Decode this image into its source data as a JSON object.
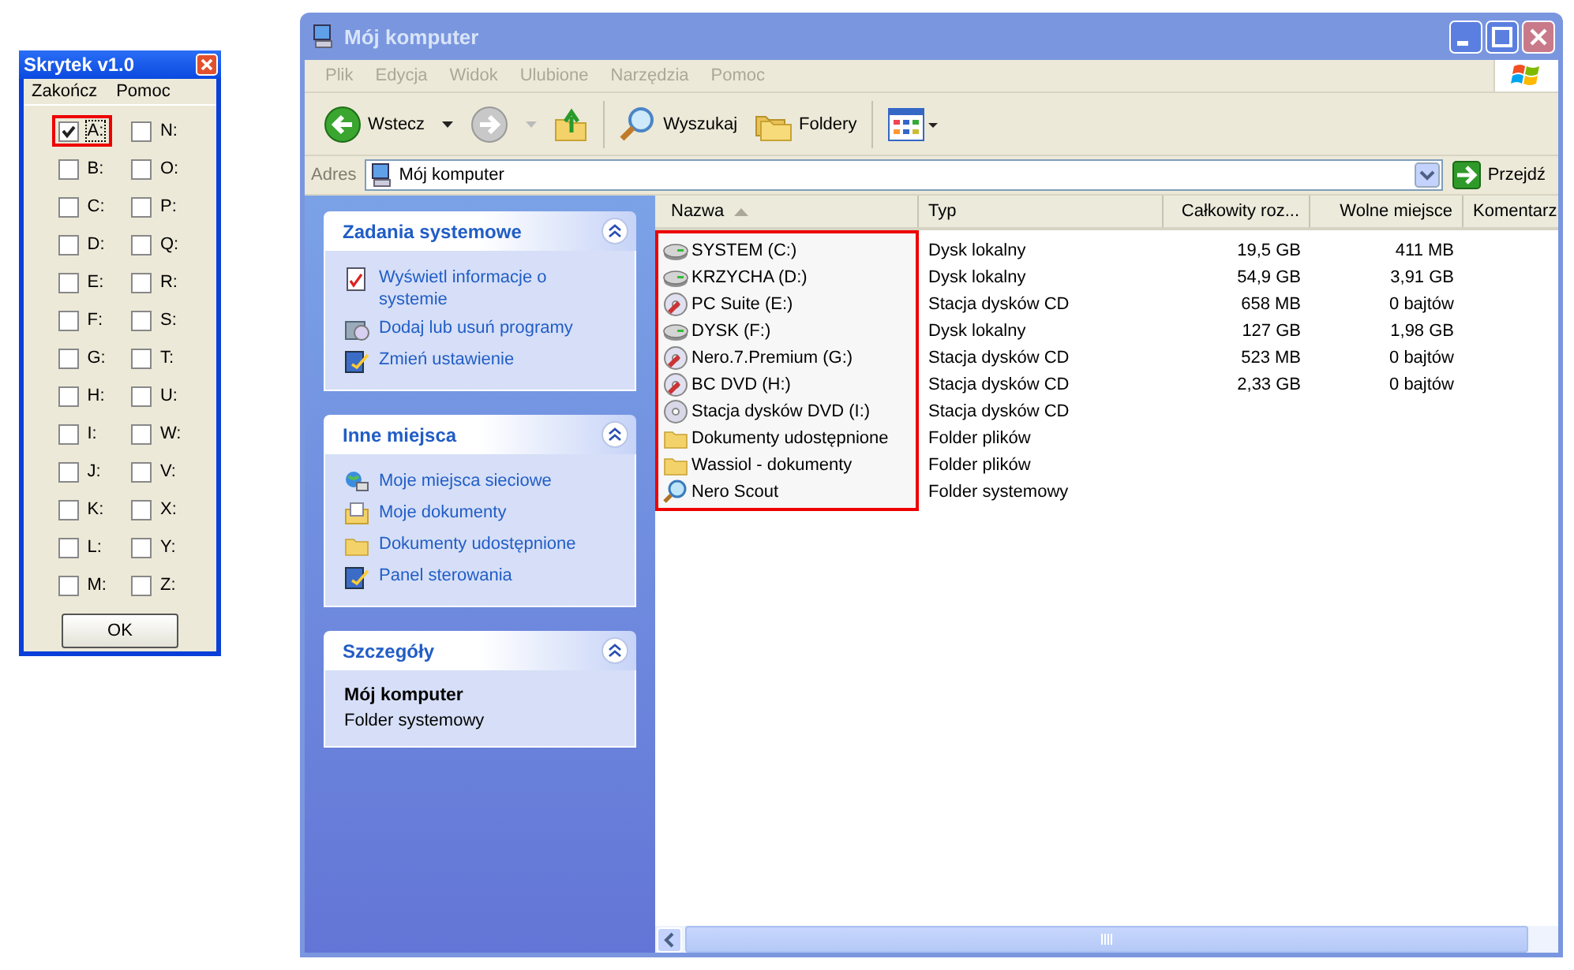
{
  "dialog": {
    "title": "Skrytek v1.0",
    "menu": [
      "Zakończ",
      "Pomoc"
    ],
    "drive_columns": [
      [
        {
          "label": "A:",
          "checked": true,
          "highlighted": true
        },
        {
          "label": "B:",
          "checked": false,
          "highlighted": false
        },
        {
          "label": "C:",
          "checked": false,
          "highlighted": false
        },
        {
          "label": "D:",
          "checked": false,
          "highlighted": false
        },
        {
          "label": "E:",
          "checked": false,
          "highlighted": false
        },
        {
          "label": "F:",
          "checked": false,
          "highlighted": false
        },
        {
          "label": "G:",
          "checked": false,
          "highlighted": false
        },
        {
          "label": "H:",
          "checked": false,
          "highlighted": false
        },
        {
          "label": "I:",
          "checked": false,
          "highlighted": false
        },
        {
          "label": "J:",
          "checked": false,
          "highlighted": false
        },
        {
          "label": "K:",
          "checked": false,
          "highlighted": false
        },
        {
          "label": "L:",
          "checked": false,
          "highlighted": false
        },
        {
          "label": "M:",
          "checked": false,
          "highlighted": false
        }
      ],
      [
        {
          "label": "N:",
          "checked": false,
          "highlighted": false
        },
        {
          "label": "O:",
          "checked": false,
          "highlighted": false
        },
        {
          "label": "P:",
          "checked": false,
          "highlighted": false
        },
        {
          "label": "Q:",
          "checked": false,
          "highlighted": false
        },
        {
          "label": "R:",
          "checked": false,
          "highlighted": false
        },
        {
          "label": "S:",
          "checked": false,
          "highlighted": false
        },
        {
          "label": "T:",
          "checked": false,
          "highlighted": false
        },
        {
          "label": "U:",
          "checked": false,
          "highlighted": false
        },
        {
          "label": "W:",
          "checked": false,
          "highlighted": false
        },
        {
          "label": "V:",
          "checked": false,
          "highlighted": false
        },
        {
          "label": "X:",
          "checked": false,
          "highlighted": false
        },
        {
          "label": "Y:",
          "checked": false,
          "highlighted": false
        },
        {
          "label": "Z:",
          "checked": false,
          "highlighted": false
        }
      ]
    ],
    "ok_button": "OK"
  },
  "explorer": {
    "title": "Mój komputer",
    "active": false,
    "menu": [
      "Plik",
      "Edycja",
      "Widok",
      "Ulubione",
      "Narzędzia",
      "Pomoc"
    ],
    "toolbar": {
      "back": "Wstecz",
      "forward_disabled": true,
      "search": "Wyszukaj",
      "folders": "Foldery"
    },
    "address": {
      "label": "Adres",
      "value": "Mój komputer",
      "go": "Przejdź"
    },
    "task_panes": [
      {
        "title": "Zadania systemowe",
        "expanded": true,
        "items": [
          {
            "label": "Wyświetl informacje o systemie",
            "kind": "info"
          },
          {
            "label": "Dodaj lub usuń programy",
            "kind": "programs"
          },
          {
            "label": "Zmień ustawienie",
            "kind": "control"
          }
        ]
      },
      {
        "title": "Inne miejsca",
        "expanded": true,
        "items": [
          {
            "label": "Moje miejsca sieciowe",
            "kind": "network"
          },
          {
            "label": "Moje dokumenty",
            "kind": "documents"
          },
          {
            "label": "Dokumenty udostępnione",
            "kind": "folder"
          },
          {
            "label": "Panel sterowania",
            "kind": "control"
          }
        ]
      }
    ],
    "details": {
      "title": "Szczegóły",
      "expanded": true,
      "name": "Mój komputer",
      "description": "Folder systemowy"
    },
    "columns": [
      "Nazwa",
      "Typ",
      "Całkowity roz...",
      "Wolne miejsce",
      "Komentarz"
    ],
    "names_highlighted": true,
    "items": [
      {
        "name": "SYSTEM (C:)",
        "kind": "hdd",
        "type": "Dysk lokalny",
        "total": "19,5 GB",
        "free": "411 MB"
      },
      {
        "name": "KRZYCHA (D:)",
        "kind": "hdd",
        "type": "Dysk lokalny",
        "total": "54,9 GB",
        "free": "3,91 GB"
      },
      {
        "name": "PC Suite (E:)",
        "kind": "cd",
        "type": "Stacja dysków CD",
        "total": "658 MB",
        "free": "0 bajtów"
      },
      {
        "name": "DYSK (F:)",
        "kind": "hdd",
        "type": "Dysk lokalny",
        "total": "127 GB",
        "free": "1,98 GB"
      },
      {
        "name": "Nero.7.Premium (G:)",
        "kind": "cd",
        "type": "Stacja dysków CD",
        "total": "523 MB",
        "free": "0 bajtów"
      },
      {
        "name": "BC DVD (H:)",
        "kind": "cd",
        "type": "Stacja dysków CD",
        "total": "2,33 GB",
        "free": "0 bajtów"
      },
      {
        "name": "Stacja dysków DVD (I:)",
        "kind": "dvd",
        "type": "Stacja dysków CD"
      },
      {
        "name": "Dokumenty udostępnione",
        "kind": "folder",
        "type": "Folder plików"
      },
      {
        "name": "Wassiol - dokumenty",
        "kind": "folder",
        "type": "Folder plików"
      },
      {
        "name": "Nero Scout",
        "kind": "search",
        "type": "Folder systemowy"
      }
    ]
  }
}
